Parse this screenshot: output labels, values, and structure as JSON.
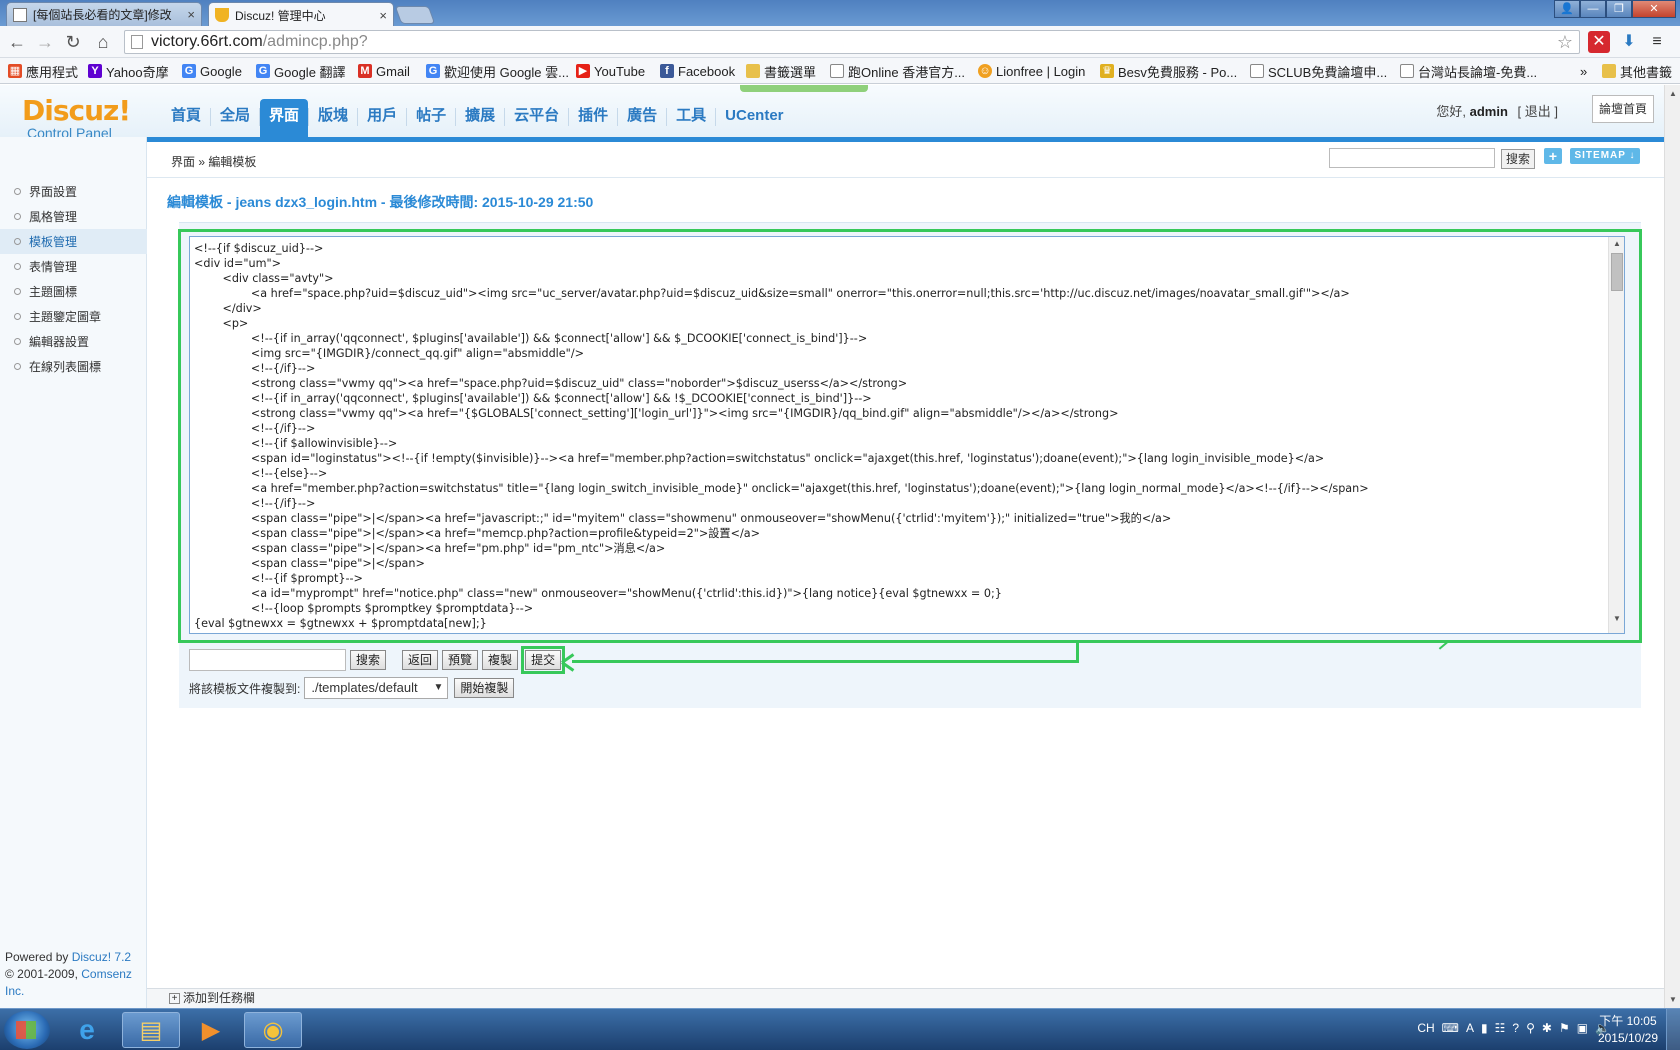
{
  "browser": {
    "tabs": [
      {
        "title": "[每個站長必看的文章]修改",
        "active": false
      },
      {
        "title": "Discuz! 管理中心",
        "active": true
      }
    ],
    "url_host": "victory.66rt.com",
    "url_path": "/admincp.php?",
    "bookmarks": [
      {
        "label": "應用程式",
        "icon": "apps-grid-icon",
        "color": "#e34c26"
      },
      {
        "label": "Yahoo奇摩",
        "icon": "yahoo-icon",
        "color": "#5f01d1"
      },
      {
        "label": "Google",
        "icon": "google-icon",
        "color": "#4285f4"
      },
      {
        "label": "Google 翻譯",
        "icon": "google-translate-icon",
        "color": "#4285f4"
      },
      {
        "label": "Gmail",
        "icon": "gmail-icon",
        "color": "#d93025"
      },
      {
        "label": "歡迎使用 Google 雲...",
        "icon": "google-icon",
        "color": "#4285f4"
      },
      {
        "label": "YouTube",
        "icon": "youtube-icon",
        "color": "#e62117"
      },
      {
        "label": "Facebook",
        "icon": "facebook-icon",
        "color": "#3b5998"
      },
      {
        "label": "書籤選單",
        "icon": "folder-icon",
        "color": "#e8c04a"
      },
      {
        "label": "跑Online 香港官方...",
        "icon": "page-icon",
        "color": "#888888"
      },
      {
        "label": "Lionfree | Login",
        "icon": "lionfree-icon",
        "color": "#f0a020"
      },
      {
        "label": "Besv免費服務 - Po...",
        "icon": "besv-icon",
        "color": "#e0b020"
      },
      {
        "label": "SCLUB免費論壇申...",
        "icon": "page-icon",
        "color": "#888888"
      },
      {
        "label": "台灣站長論壇-免費...",
        "icon": "page-icon",
        "color": "#888888"
      }
    ],
    "bookmarks_overflow": "»",
    "other_bookmarks": "其他書籤"
  },
  "admin": {
    "logo_brand": "Discuz!",
    "logo_sub": "Control Panel",
    "nav": [
      "首頁",
      "全局",
      "界面",
      "版塊",
      "用戶",
      "帖子",
      "擴展",
      "云平台",
      "插件",
      "廣告",
      "工具",
      "UCenter"
    ],
    "nav_active": "界面",
    "greeting": "您好,",
    "username": "admin",
    "logout": "[ 退出 ]",
    "forum_home": "論壇首頁",
    "breadcrumb": "界面 » 編輯模板",
    "search_button": "搜索",
    "plus_label": "+",
    "sitemap_label": "SITEMAP ↓",
    "sidebar": [
      {
        "label": "界面設置",
        "active": false
      },
      {
        "label": "風格管理",
        "active": false
      },
      {
        "label": "模板管理",
        "active": true
      },
      {
        "label": "表情管理",
        "active": false
      },
      {
        "label": "主題圖標",
        "active": false
      },
      {
        "label": "主題鑒定圖章",
        "active": false
      },
      {
        "label": "編輯器設置",
        "active": false
      },
      {
        "label": "在線列表圖標",
        "active": false
      }
    ],
    "footer_powered": "Powered by",
    "footer_powered_link": "Discuz! 7.2",
    "footer_copy": "© 2001-2009,",
    "footer_copy_link": "Comsenz Inc.",
    "page_title": "編輯模板 - jeans dzx3_login.htm - 最後修改時間: 2015-10-29 21:50",
    "code_lines": [
      "<!--{if $discuz_uid}-->",
      "<div id=\"um\">",
      "        <div class=\"avty\">",
      "                <a href=\"space.php?uid=$discuz_uid\"><img src=\"uc_server/avatar.php?uid=$discuz_uid&size=small\" onerror=\"this.onerror=null;this.src='http://uc.discuz.net/images/noavatar_small.gif'\"></a>",
      "        </div>",
      "        <p>",
      "                <!--{if in_array('qqconnect', $plugins['available']) && $connect['allow'] && $_DCOOKIE['connect_is_bind']}-->",
      "                <img src=\"{IMGDIR}/connect_qq.gif\" align=\"absmiddle\"/>",
      "                <!--{/if}-->",
      "                <strong class=\"vwmy qq\"><a href=\"space.php?uid=$discuz_uid\" class=\"noborder\">$discuz_userss</a></strong>",
      "                <!--{if in_array('qqconnect', $plugins['available']) && $connect['allow'] && !$_DCOOKIE['connect_is_bind']}-->",
      "                <strong class=\"vwmy qq\"><a href=\"{$GLOBALS['connect_setting']['login_url']}\"><img src=\"{IMGDIR}/qq_bind.gif\" align=\"absmiddle\"/></a></strong>",
      "                <!--{/if}-->",
      "                <!--{if $allowinvisible}-->",
      "                <span id=\"loginstatus\"><!--{if !empty($invisible)}--><a href=\"member.php?action=switchstatus\" onclick=\"ajaxget(this.href, 'loginstatus');doane(event);\">{lang login_invisible_mode}</a>",
      "                <!--{else}-->",
      "                <a href=\"member.php?action=switchstatus\" title=\"{lang login_switch_invisible_mode}\" onclick=\"ajaxget(this.href, 'loginstatus');doane(event);\">{lang login_normal_mode}</a><!--{/if}--></span>",
      "                <!--{/if}-->",
      "                <span class=\"pipe\">|</span><a href=\"javascript:;\" id=\"myitem\" class=\"showmenu\" onmouseover=\"showMenu({'ctrlid':'myitem'});\" initialized=\"true\">我的</a>",
      "                <span class=\"pipe\">|</span><a href=\"memcp.php?action=profile&typeid=2\">設置</a>",
      "                <span class=\"pipe\">|</span><a href=\"pm.php\" id=\"pm_ntc\">消息</a>",
      "                <span class=\"pipe\">|</span>",
      "                <!--{if $prompt}-->",
      "                <a id=\"myprompt\" href=\"notice.php\" class=\"new\" onmouseover=\"showMenu({'ctrlid':this.id})\">{lang notice}{eval $gtnewxx = 0;}",
      "                <!--{loop $prompts $promptkey $promptdata}-->",
      "{eval $gtnewxx = $gtnewxx + $promptdata[new];}"
    ],
    "actions": {
      "search": "搜索",
      "back": "返回",
      "preview": "預覽",
      "copy": "複製",
      "submit": "提交"
    },
    "copy_label": "將該模板文件複製到:",
    "copy_target": "./templates/default",
    "copy_start": "開始複製",
    "status_task": "添加到任務欄"
  },
  "taskbar": {
    "ime": "CH",
    "time": "下午 10:05",
    "date": "2015/10/29"
  },
  "colors": {
    "accent": "#2b8ad6",
    "annotation": "#37c85a",
    "logo": "#f29c1b"
  }
}
